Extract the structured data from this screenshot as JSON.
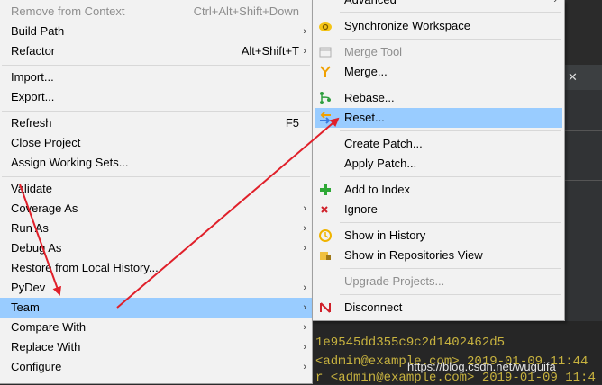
{
  "main_menu": {
    "remove_from_context": "Remove from Context",
    "remove_from_context_shortcut": "Ctrl+Alt+Shift+Down",
    "build_path": "Build Path",
    "refactor": "Refactor",
    "refactor_shortcut": "Alt+Shift+T",
    "import": "Import...",
    "export": "Export...",
    "refresh": "Refresh",
    "refresh_shortcut": "F5",
    "close_project": "Close Project",
    "assign_working_sets": "Assign Working Sets...",
    "validate": "Validate",
    "coverage_as": "Coverage As",
    "run_as": "Run As",
    "debug_as": "Debug As",
    "restore_local_history": "Restore from Local History...",
    "pydev": "PyDev",
    "team": "Team",
    "compare_with": "Compare With",
    "replace_with": "Replace With",
    "configure": "Configure",
    "submenu_arrow": "›"
  },
  "team_menu": {
    "advanced": "Advanced",
    "synchronize_workspace": "Synchronize Workspace",
    "merge_tool": "Merge Tool",
    "merge": "Merge...",
    "rebase": "Rebase...",
    "reset": "Reset...",
    "create_patch": "Create Patch...",
    "apply_patch": "Apply Patch...",
    "add_to_index": "Add to Index",
    "ignore": "Ignore",
    "show_in_history": "Show in History",
    "show_in_repositories_view": "Show in Repositories View",
    "upgrade_projects": "Upgrade Projects...",
    "disconnect": "Disconnect"
  },
  "background": {
    "commit_hash_partial": "1e9545dd355c9c2d1402462d5",
    "author_line_1": "<admin@example.com> 2019-01-09 11:44",
    "author_line_2": "r <admin@example.com> 2019-01-09 11:4",
    "close_glyph": "✕",
    "watermark": "https://blog.csdn.net/wuguifa"
  },
  "icons": {
    "synchronize": "sync-icon",
    "merge_tool": "merge-tool-icon",
    "merge": "merge-icon",
    "rebase": "rebase-icon",
    "reset": "reset-icon",
    "add_to_index": "add-icon",
    "ignore": "ignore-icon",
    "show_in_history": "history-icon",
    "show_in_repositories_view": "repositories-icon",
    "disconnect": "disconnect-icon"
  },
  "colors": {
    "menu_background": "#f2f2f2",
    "selection": "#99ccff",
    "annotation_arrow": "#e0202a",
    "code_text": "#c8b33f"
  }
}
